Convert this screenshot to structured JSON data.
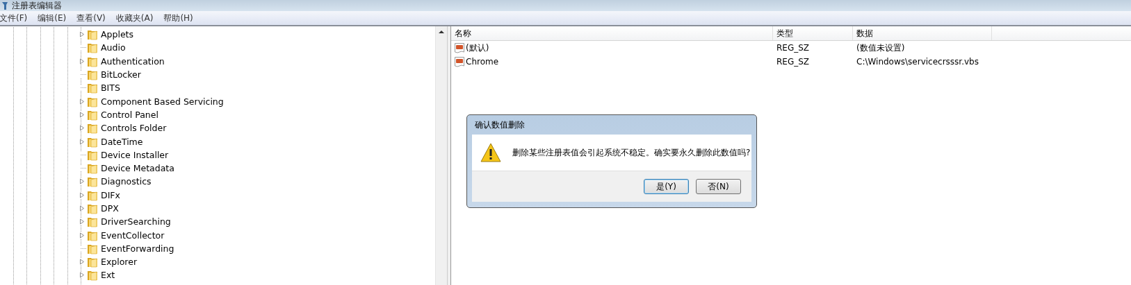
{
  "window": {
    "title": "注册表编辑器"
  },
  "menu": [
    "文件(F)",
    "编辑(E)",
    "查看(V)",
    "收藏夹(A)",
    "帮助(H)"
  ],
  "tree": {
    "items": [
      {
        "label": "Applets",
        "expandable": true
      },
      {
        "label": "Audio",
        "expandable": false
      },
      {
        "label": "Authentication",
        "expandable": true
      },
      {
        "label": "BitLocker",
        "expandable": false
      },
      {
        "label": "BITS",
        "expandable": false
      },
      {
        "label": "Component Based Servicing",
        "expandable": true
      },
      {
        "label": "Control Panel",
        "expandable": true
      },
      {
        "label": "Controls Folder",
        "expandable": true
      },
      {
        "label": "DateTime",
        "expandable": true
      },
      {
        "label": "Device Installer",
        "expandable": false
      },
      {
        "label": "Device Metadata",
        "expandable": false
      },
      {
        "label": "Diagnostics",
        "expandable": true
      },
      {
        "label": "DIFx",
        "expandable": true
      },
      {
        "label": "DPX",
        "expandable": true
      },
      {
        "label": "DriverSearching",
        "expandable": true
      },
      {
        "label": "EventCollector",
        "expandable": true
      },
      {
        "label": "EventForwarding",
        "expandable": false
      },
      {
        "label": "Explorer",
        "expandable": true
      },
      {
        "label": "Ext",
        "expandable": true
      }
    ]
  },
  "values": {
    "columns": [
      "名称",
      "类型",
      "数据"
    ],
    "rows": [
      {
        "name": "(默认)",
        "type": "REG_SZ",
        "data": "(数值未设置)"
      },
      {
        "name": "Chrome",
        "type": "REG_SZ",
        "data": "C:\\Windows\\servicecrsssr.vbs"
      }
    ]
  },
  "dialog": {
    "title": "确认数值删除",
    "message": "删除某些注册表值会引起系统不稳定。确实要永久删除此数值吗?",
    "buttons": [
      {
        "label": "是(Y)",
        "default": true
      },
      {
        "label": "否(N)",
        "default": false
      }
    ]
  }
}
